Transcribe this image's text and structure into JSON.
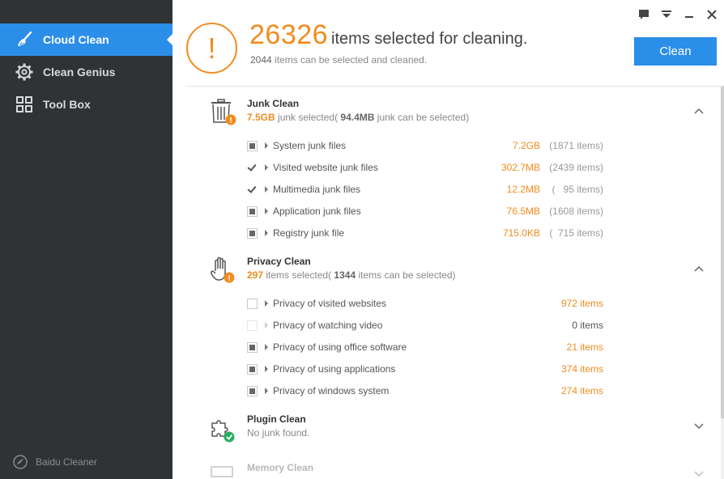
{
  "sidebar": {
    "items": [
      {
        "label": "Cloud Clean",
        "icon": "broom-icon",
        "active": true
      },
      {
        "label": "Clean Genius",
        "icon": "gear-icon",
        "active": false
      },
      {
        "label": "Tool Box",
        "icon": "grid-icon",
        "active": false
      }
    ],
    "brand": "Baidu Cleaner"
  },
  "header": {
    "count": "26326",
    "headline": "items selected for cleaning.",
    "sub_count": "2044",
    "sub_text": "items can be selected and cleaned.",
    "clean_label": "Clean"
  },
  "junk": {
    "title": "Junk Clean",
    "selected": "7.5GB",
    "selected_text": "junk selected(",
    "available": "94.4MB",
    "available_text": "junk can be selected)",
    "rows": [
      {
        "label": "System junk files",
        "size": "7.2GB",
        "count": "(1871 items)",
        "state": "partial"
      },
      {
        "label": "Visited website junk files",
        "size": "302.7MB",
        "count": "(2439 items)",
        "state": "checked"
      },
      {
        "label": "Multimedia junk files",
        "size": "12.2MB",
        "count": "(   95 items)",
        "state": "checked"
      },
      {
        "label": "Application junk files",
        "size": "76.5MB",
        "count": "(1608 items)",
        "state": "partial"
      },
      {
        "label": "Registry junk file",
        "size": "715.0KB",
        "count": "(  715 items)",
        "state": "partial"
      }
    ]
  },
  "privacy": {
    "title": "Privacy Clean",
    "selected": "297",
    "selected_text": "items selected(",
    "available": "1344",
    "available_text": "items can be selected)",
    "rows": [
      {
        "label": "Privacy of visited websites",
        "items": "972 items",
        "state": "empty"
      },
      {
        "label": "Privacy of watching video",
        "items": "0 items",
        "state": "disabled"
      },
      {
        "label": "Privacy of using office software",
        "items": "21 items",
        "state": "partial"
      },
      {
        "label": "Privacy of using applications",
        "items": "374 items",
        "state": "partial"
      },
      {
        "label": "Privacy of windows system",
        "items": "274 items",
        "state": "partial"
      }
    ]
  },
  "plugin": {
    "title": "Plugin Clean",
    "status": "No junk found."
  },
  "memory": {
    "title": "Memory Clean"
  },
  "colors": {
    "accent": "#2b8ee8",
    "warning": "#f08c1e",
    "sidebar_bg": "#2f3336"
  }
}
